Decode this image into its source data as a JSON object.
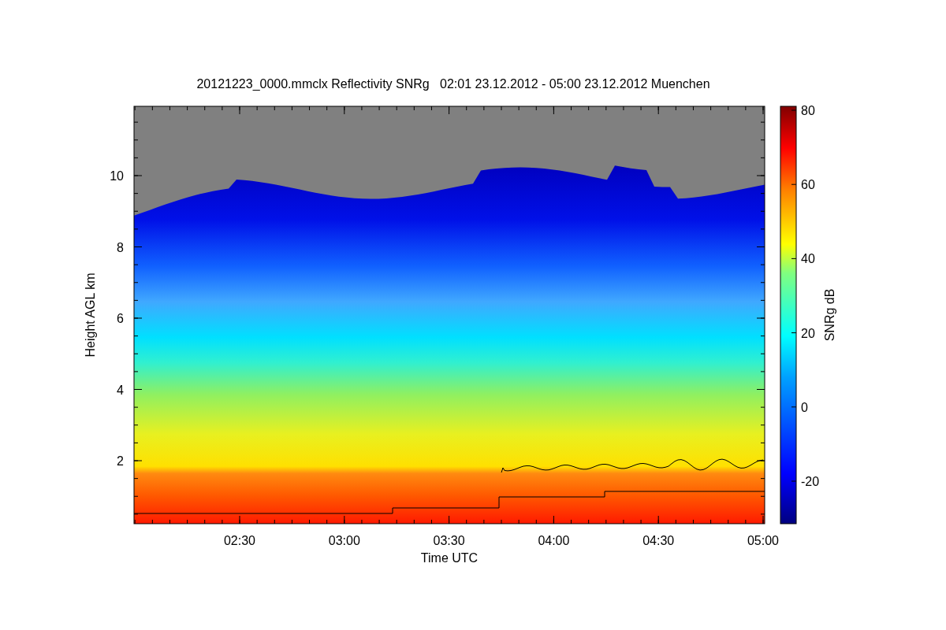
{
  "title": "20121223_0000.mmclx Reflectivity SNRg   02:01 23.12.2012 - 05:00 23.12.2012 Muenchen",
  "x_axis": {
    "label": "Time UTC",
    "ticks": [
      "02:30",
      "03:00",
      "03:30",
      "04:00",
      "04:30",
      "05:00"
    ]
  },
  "y_axis": {
    "label": "Height AGL km",
    "ticks": [
      "10",
      "8",
      "6",
      "4",
      "2"
    ]
  },
  "colorbar": {
    "label": "SNRg dB",
    "ticks": [
      "80",
      "60",
      "40",
      "20",
      "0",
      "-20"
    ]
  }
}
